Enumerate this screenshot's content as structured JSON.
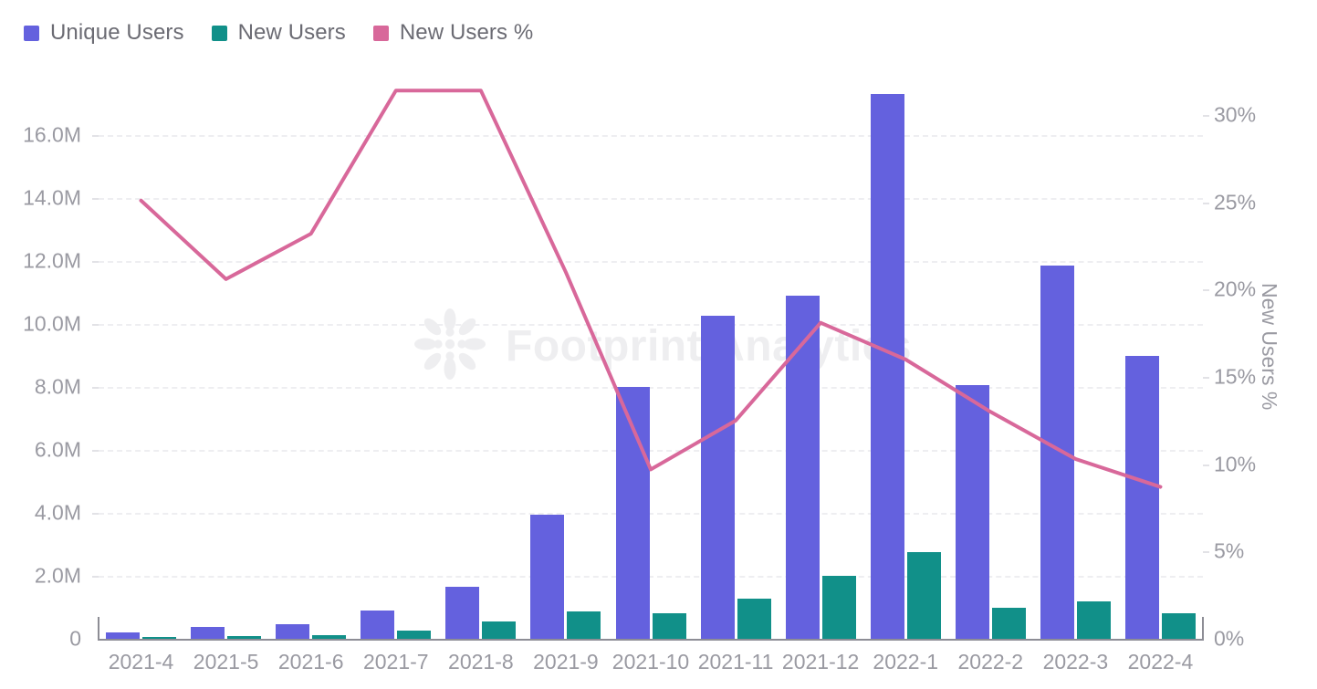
{
  "legend": {
    "items": [
      {
        "label": "Unique Users",
        "color": "#6461de"
      },
      {
        "label": "New Users",
        "color": "#119089"
      },
      {
        "label": "New Users %",
        "color": "#d8689a"
      }
    ]
  },
  "watermark": {
    "text": "Footprint Analytics",
    "logo_icon": "flower-logo-icon"
  },
  "axes": {
    "left": {
      "ticks": [
        "0",
        "2.0M",
        "4.0M",
        "6.0M",
        "8.0M",
        "10.0M",
        "12.0M",
        "14.0M",
        "16.0M"
      ],
      "tick_values": [
        0,
        2000000,
        4000000,
        6000000,
        8000000,
        10000000,
        12000000,
        14000000,
        16000000
      ],
      "min": 0,
      "max": 16000000
    },
    "right": {
      "title": "New Users %",
      "ticks": [
        "0%",
        "5%",
        "10%",
        "15%",
        "20%",
        "25%",
        "30%"
      ],
      "tick_values": [
        0,
        5,
        10,
        15,
        20,
        25,
        30
      ],
      "min": 0,
      "max": 30
    }
  },
  "chart_data": {
    "type": "bar",
    "title": "",
    "xlabel": "",
    "ylabel": "",
    "grid": true,
    "legend_position": "top-left",
    "categories": [
      "2021-4",
      "2021-5",
      "2021-6",
      "2021-7",
      "2021-8",
      "2021-9",
      "2021-10",
      "2021-11",
      "2021-12",
      "2022-1",
      "2022-2",
      "2022-3",
      "2022-4"
    ],
    "series": [
      {
        "name": "Unique Users",
        "type": "bar",
        "axis": "left",
        "color": "#6461de",
        "unit": "users",
        "values": [
          200000,
          370000,
          470000,
          900000,
          1650000,
          3950000,
          8000000,
          10250000,
          10900000,
          17300000,
          8050000,
          11850000,
          9000000
        ],
        "labels": [
          "0.2M",
          "0.37M",
          "0.47M",
          "0.9M",
          "1.65M",
          "3.95M",
          "8.0M",
          "10.25M",
          "10.9M",
          "17.3M",
          "8.05M",
          "11.85M",
          "9.0M"
        ]
      },
      {
        "name": "New Users",
        "type": "bar",
        "axis": "left",
        "color": "#119089",
        "unit": "users",
        "values": [
          50000,
          100000,
          120000,
          250000,
          550000,
          870000,
          800000,
          1270000,
          2000000,
          2750000,
          1000000,
          1200000,
          800000
        ],
        "labels": [
          "0.05M",
          "0.1M",
          "0.12M",
          "0.25M",
          "0.55M",
          "0.87M",
          "0.8M",
          "1.27M",
          "2.0M",
          "2.75M",
          "1.0M",
          "1.2M",
          "0.8M"
        ]
      },
      {
        "name": "New Users %",
        "type": "line",
        "axis": "right",
        "color": "#d8689a",
        "unit": "percent",
        "values": [
          25.1,
          20.6,
          23.2,
          31.4,
          31.4,
          21.0,
          9.7,
          12.5,
          18.1,
          16.0,
          13.0,
          10.3,
          8.7
        ],
        "labels": [
          "25.1%",
          "20.6%",
          "23.2%",
          "31.4%",
          "31.4%",
          "21.0%",
          "9.7%",
          "12.5%",
          "18.1%",
          "16.0%",
          "13.0%",
          "10.3%",
          "8.7%"
        ]
      }
    ]
  }
}
